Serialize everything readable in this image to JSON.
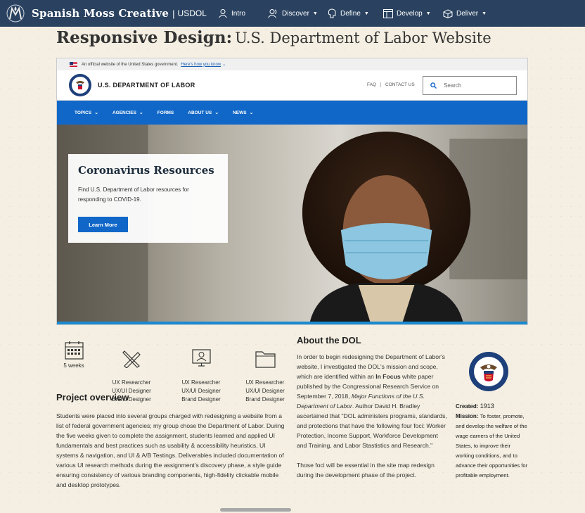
{
  "nav": {
    "brand": "Spanish Moss Creative",
    "separator": "|",
    "subtitle": "USDOL",
    "items": [
      {
        "label": "Intro",
        "icon": "person-icon",
        "dropdown": false
      },
      {
        "label": "Discover",
        "icon": "people-icon",
        "dropdown": true
      },
      {
        "label": "Define",
        "icon": "brain-icon",
        "dropdown": true
      },
      {
        "label": "Develop",
        "icon": "layout-icon",
        "dropdown": true
      },
      {
        "label": "Deliver",
        "icon": "box-icon",
        "dropdown": true
      }
    ]
  },
  "page": {
    "title_bold": "Responsive Design:",
    "title_rest": "U.S. Department of  Labor Website"
  },
  "mock": {
    "gov_banner": "An official website of the United States government.",
    "gov_link": "Here's how you know",
    "dept_name": "U.S. DEPARTMENT OF LABOR",
    "header_links": [
      "FAQ",
      "CONTACT US"
    ],
    "search_placeholder": "Search",
    "menu": [
      "TOPICS",
      "AGENCIES",
      "FORMS",
      "ABOUT US",
      "NEWS"
    ],
    "promo_title": "Coronavirus Resources",
    "promo_text": "Find U.S. Department of Labor resources for responding to COVID-19.",
    "promo_button": "Learn More"
  },
  "roles": {
    "duration": "5 weeks",
    "items": [
      "UX Researcher\nUX/UI Designer\nBrand Designer",
      "UX Researcher\nUX/UI Designer\nBrand Designer",
      "UX Researcher\nUX/UI Designer\nBrand Designer"
    ]
  },
  "overview": {
    "heading": "Project overview",
    "text": "Students were placed into several groups charged with redesigning a website from a list of federal government agencies; my group chose the Department of Labor. During the five weeks given to complete the assignment, students learned and applied UI fundamentals and best practices such as usability & accessibility heuristics, UI systems & navigation, and UI & A/B Testings. Deliverables included documentation of various UI research methods during the assignment's discovery phase, a style guide ensuring consistency of various branding components, high-fidelity clickable mobile and desktop prototypes."
  },
  "about": {
    "heading": "About the DOL",
    "p1_a": "In order to begin redesigning the Department of Labor's website, I investigated the DOL's mission and scope, which are identified within an ",
    "p1_bold": "In Focus",
    "p1_b": " white paper published by the Congressional Research Service on September 7, 2018, ",
    "p1_italic": "Major Functions of the U.S. Department of Labor",
    "p1_c": ". Author David H. Bradley ascertained that \"DOL administers programs, standards, and protections that have the following four foci: Worker Protection, Income Support, Workforce Development and Training, and Labor Stastistics and Research.\"",
    "p2": "Those foci will be essential in the site map redesign during the development phase of the project."
  },
  "facts": {
    "created_label": "Created:",
    "created_value": "1913",
    "mission_label": "Mission:",
    "mission_value": "To foster, promote, and develop the welfare of the wage earners of the United States, to improve their working conditions, and to advance their opportunities for profitable employment."
  }
}
